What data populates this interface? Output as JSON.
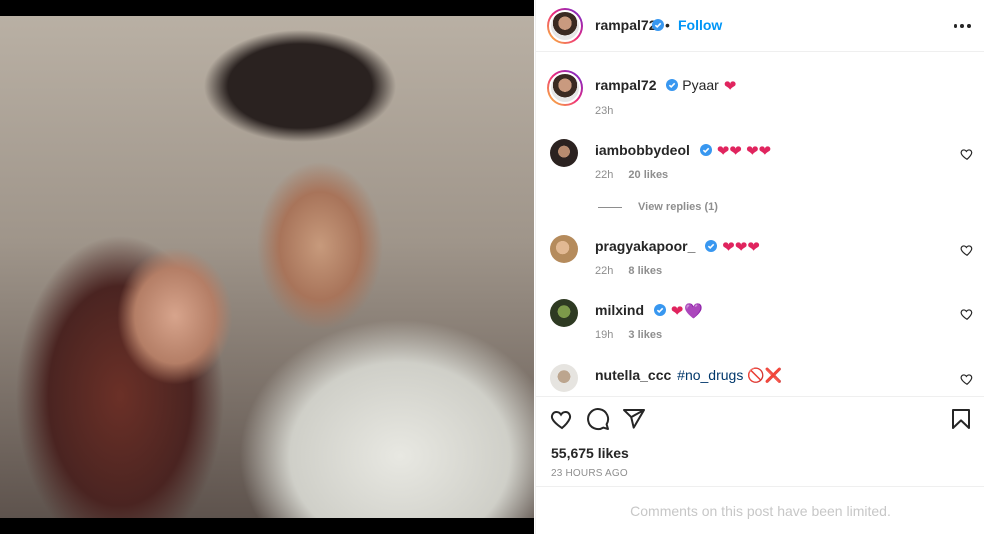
{
  "post": {
    "author": "rampal72",
    "follow_label": "Follow",
    "separator": "•",
    "caption_text": "Pyaar",
    "caption_time": "23h",
    "likes": "55,675 likes",
    "time_ago": "23 HOURS AGO",
    "limited_notice": "Comments on this post have been limited."
  },
  "comments": [
    {
      "user": "iambobbydeol",
      "text": "",
      "emoji": "❤❤ ❤❤",
      "time": "22h",
      "likes": "20 likes",
      "verified": true
    },
    {
      "user": "pragyakapoor_",
      "text": "",
      "emoji": "❤❤❤",
      "time": "22h",
      "likes": "8 likes",
      "verified": true
    },
    {
      "user": "milxind",
      "text": "",
      "emoji": "❤",
      "emoji2": "💜",
      "time": "19h",
      "likes": "3 likes",
      "verified": true
    },
    {
      "user": "nutella_ccc",
      "text": "#no_drugs",
      "emoji": "🚫❌",
      "time": "",
      "likes": "",
      "verified": false
    }
  ],
  "view_replies": "View replies (1)",
  "colors": {
    "accent": "#0095f6",
    "verified": "#3897f0",
    "heart": "#e0245e",
    "muted": "#8e8e8e"
  },
  "icons": [
    "more-icon",
    "verified-icon",
    "heart-icon",
    "comment-icon",
    "share-icon",
    "bookmark-icon"
  ]
}
